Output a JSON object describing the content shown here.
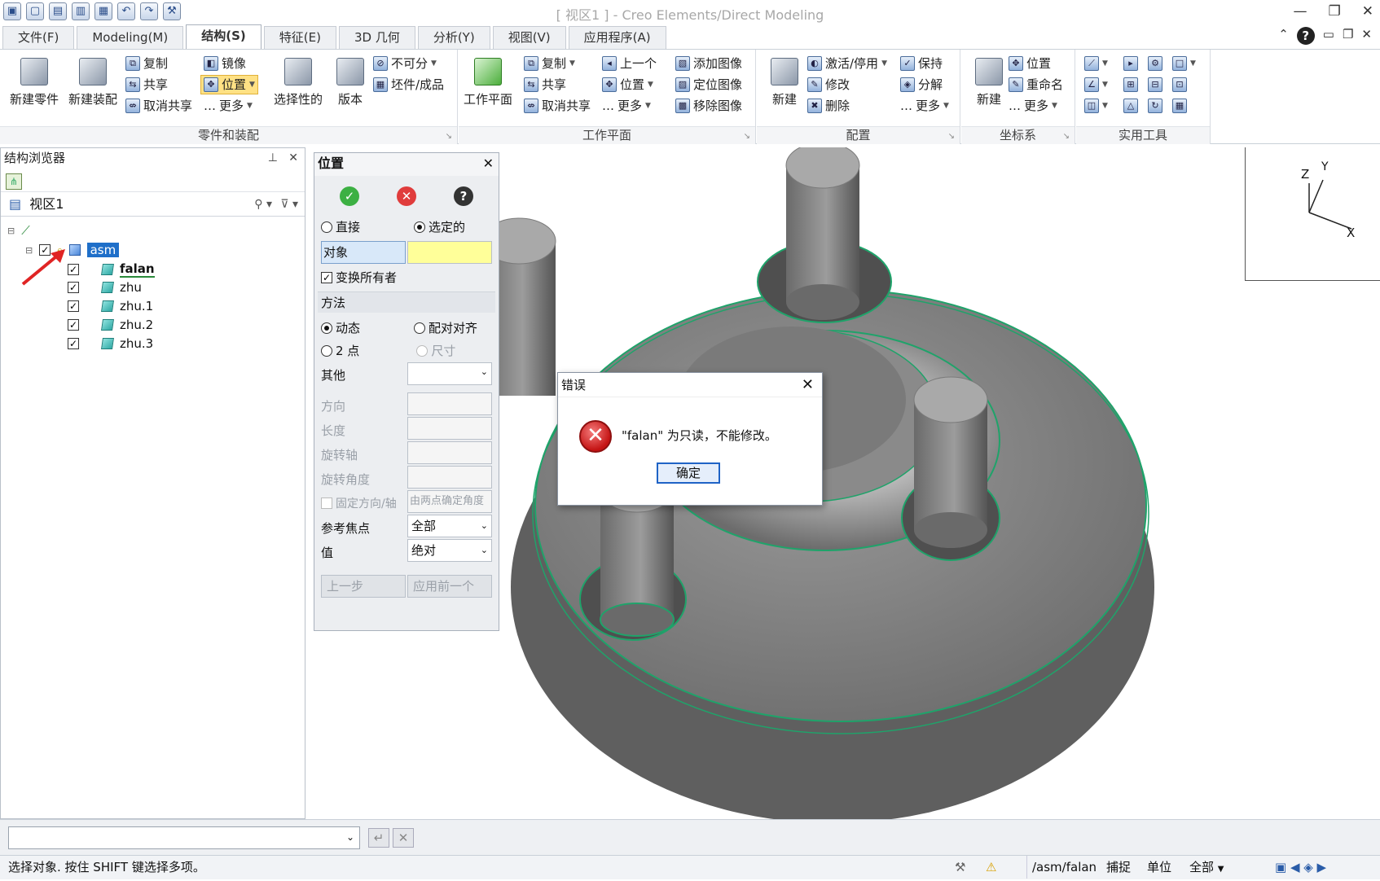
{
  "window": {
    "title": "[ 视区1 ] - Creo Elements/Direct Modeling"
  },
  "tabs": [
    "文件(F)",
    "Modeling(M)",
    "结构(S)",
    "特征(E)",
    "3D 几何",
    "分析(Y)",
    "视图(V)",
    "应用程序(A)"
  ],
  "active_tab": "结构(S)",
  "ribbon": {
    "parts": {
      "label": "零件和装配",
      "new_part": "新建零件",
      "new_assembly": "新建装配",
      "copy": "复制",
      "share": "共享",
      "unshare": "取消共享",
      "mirror": "镜像",
      "position": "位置",
      "more": "更多",
      "selective": "选择性的",
      "version": "版本",
      "no_change": "不可分",
      "stock": "坯件/成品"
    },
    "workplane": {
      "label": "工作平面",
      "wp": "工作平面",
      "copy": "复制",
      "share": "共享",
      "unshare": "取消共享",
      "prev": "上一个",
      "position": "位置",
      "more": "更多",
      "add_image": "添加图像",
      "locate_image": "定位图像",
      "remove_image": "移除图像"
    },
    "config": {
      "label": "配置",
      "new": "新建",
      "activate": "激活/停用",
      "modify": "修改",
      "delete": "删除",
      "keep": "保持",
      "decompose": "分解",
      "more": "更多"
    },
    "coord": {
      "label": "坐标系",
      "new": "新建",
      "position": "位置",
      "rename": "重命名",
      "more": "更多"
    },
    "utils": {
      "label": "实用工具"
    }
  },
  "browser": {
    "title": "结构浏览器",
    "view": "视区1",
    "items": [
      {
        "label": "asm"
      },
      {
        "label": "falan"
      },
      {
        "label": "zhu"
      },
      {
        "label": "zhu.1"
      },
      {
        "label": "zhu.2"
      },
      {
        "label": "zhu.3"
      }
    ]
  },
  "location_dialog": {
    "title": "位置",
    "direct": "直接",
    "selected": "选定的",
    "object_label": "对象",
    "transform_owner": "变换所有者",
    "method_header": "方法",
    "dynamic": "动态",
    "pair_align": "配对对齐",
    "two_point": "2 点",
    "dimension": "尺寸",
    "other": "其他",
    "direction": "方向",
    "length": "长度",
    "rot_axis": "旋转轴",
    "rot_angle": "旋转角度",
    "fix_dir": "固定方向/轴",
    "two_pt_angle": "由两点确定角度",
    "ref_focus": "参考焦点",
    "ref_focus_value": "全部",
    "value_label": "值",
    "value_value": "绝对",
    "prev_step": "上一步",
    "apply_prev": "应用前一个"
  },
  "error_dialog": {
    "title": "错误",
    "message": "\"falan\" 为只读，不能修改。",
    "ok": "确定"
  },
  "status": {
    "prompt": "选择对象. 按住 SHIFT 键选择多项。",
    "path": "/asm/falan",
    "snap": "捕捉",
    "unit": "单位",
    "all": "全部"
  },
  "axes": {
    "z": "Z",
    "y": "Y",
    "x": "X"
  },
  "colors": {
    "accent": "#1f6fc9",
    "highlight": "#ffe184",
    "yellow_field": "#ffff99",
    "model_gray": "#7d7d7d",
    "edge_green": "#1fa36a"
  }
}
